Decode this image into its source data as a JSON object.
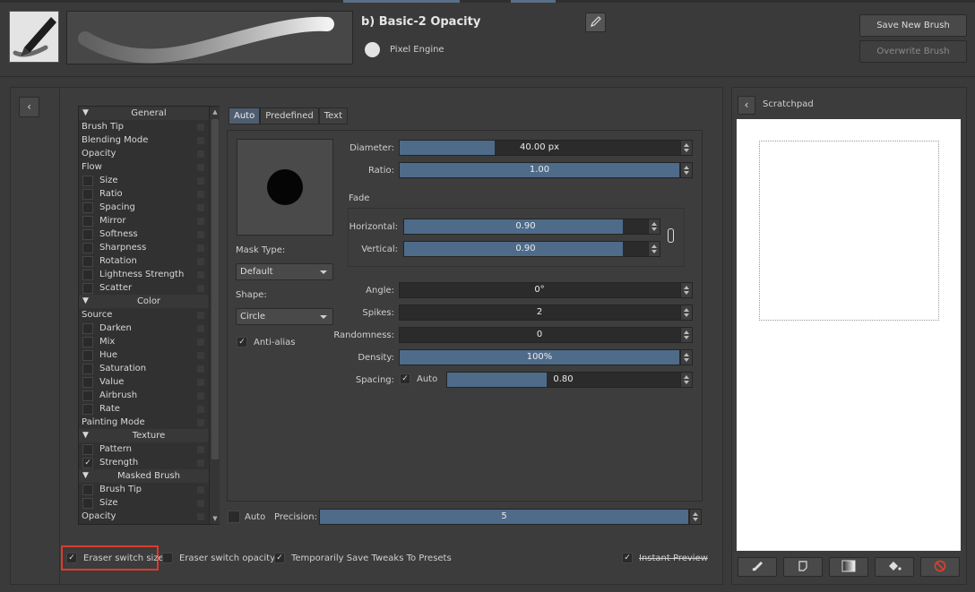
{
  "preset": {
    "name": "b) Basic-2 Opacity",
    "engine": "Pixel Engine",
    "save_button": "Save New Brush Preset...",
    "overwrite_button": "Overwrite Brush"
  },
  "option_list": [
    {
      "label": "General",
      "kind": "header"
    },
    {
      "label": "Brush Tip",
      "kind": "plain"
    },
    {
      "label": "Blending Mode",
      "kind": "plain"
    },
    {
      "label": "Opacity",
      "kind": "plain"
    },
    {
      "label": "Flow",
      "kind": "plain"
    },
    {
      "label": "Size",
      "kind": "check",
      "checked": false
    },
    {
      "label": "Ratio",
      "kind": "check",
      "checked": false
    },
    {
      "label": "Spacing",
      "kind": "check",
      "checked": false
    },
    {
      "label": "Mirror",
      "kind": "check",
      "checked": false
    },
    {
      "label": "Softness",
      "kind": "check",
      "checked": false
    },
    {
      "label": "Sharpness",
      "kind": "check",
      "checked": false
    },
    {
      "label": "Rotation",
      "kind": "check",
      "checked": false
    },
    {
      "label": "Lightness Strength",
      "kind": "check",
      "checked": false
    },
    {
      "label": "Scatter",
      "kind": "check",
      "checked": false
    },
    {
      "label": "Color",
      "kind": "header"
    },
    {
      "label": "Source",
      "kind": "plain"
    },
    {
      "label": "Darken",
      "kind": "check",
      "checked": false
    },
    {
      "label": "Mix",
      "kind": "check",
      "checked": false
    },
    {
      "label": "Hue",
      "kind": "check",
      "checked": false
    },
    {
      "label": "Saturation",
      "kind": "check",
      "checked": false
    },
    {
      "label": "Value",
      "kind": "check",
      "checked": false
    },
    {
      "label": "Airbrush",
      "kind": "check",
      "checked": false
    },
    {
      "label": "Rate",
      "kind": "check",
      "checked": false
    },
    {
      "label": "Painting Mode",
      "kind": "plain"
    },
    {
      "label": "Texture",
      "kind": "header"
    },
    {
      "label": "Pattern",
      "kind": "check",
      "checked": false
    },
    {
      "label": "Strength",
      "kind": "check",
      "checked": true
    },
    {
      "label": "Masked Brush",
      "kind": "header"
    },
    {
      "label": "Brush Tip",
      "kind": "check",
      "checked": false
    },
    {
      "label": "Size",
      "kind": "check",
      "checked": false
    },
    {
      "label": "Opacity",
      "kind": "plain"
    }
  ],
  "tabs": [
    "Auto",
    "Predefined",
    "Text"
  ],
  "mask": {
    "mask_type_label": "Mask Type:",
    "mask_type_value": "Default",
    "shape_label": "Shape:",
    "shape_value": "Circle",
    "antialias_label": "Anti-alias"
  },
  "params": {
    "diameter": {
      "label": "Diameter:",
      "value": "40.00 px",
      "fill": 0.34
    },
    "ratio": {
      "label": "Ratio:",
      "value": "1.00",
      "fill": 1.0
    },
    "fade_label": "Fade",
    "horizontal": {
      "label": "Horizontal:",
      "value": "0.90",
      "fill": 0.9
    },
    "vertical": {
      "label": "Vertical:",
      "value": "0.90",
      "fill": 0.9
    },
    "angle": {
      "label": "Angle:",
      "value": "0°",
      "fill": 0.0
    },
    "spikes": {
      "label": "Spikes:",
      "value": "2",
      "fill": 0.0
    },
    "randomness": {
      "label": "Randomness:",
      "value": "0",
      "fill": 0.0
    },
    "density": {
      "label": "Density:",
      "value": "100%",
      "fill": 1.0
    },
    "spacing": {
      "label": "Spacing:",
      "auto_label": "Auto",
      "value": "0.80",
      "fill": 0.43
    }
  },
  "precision": {
    "auto_label": "Auto",
    "label": "Precision:",
    "value": "5",
    "fill": 1.0
  },
  "footer": {
    "eraser_size": "Eraser switch size",
    "eraser_opacity": "Eraser switch opacity",
    "temp_save": "Temporarily Save Tweaks To Presets",
    "instant_preview": "Instant Preview"
  },
  "scratchpad": {
    "title": "Scratchpad"
  },
  "colors": {
    "accent": "#4e6b8a",
    "highlight": "#e0392b"
  }
}
